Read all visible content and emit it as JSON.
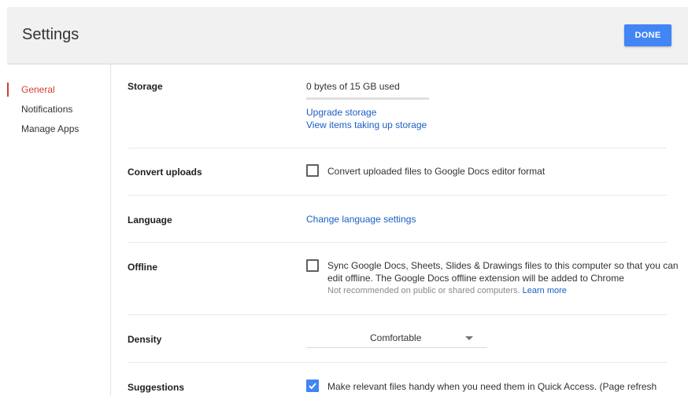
{
  "header": {
    "title": "Settings",
    "done_label": "DONE"
  },
  "sidebar": {
    "items": [
      {
        "label": "General",
        "active": true
      },
      {
        "label": "Notifications",
        "active": false
      },
      {
        "label": "Manage Apps",
        "active": false
      }
    ]
  },
  "storage": {
    "label": "Storage",
    "usage": "0 bytes of 15 GB used",
    "usage_fraction": 0,
    "upgrade_link": "Upgrade storage",
    "view_items_link": "View items taking up storage"
  },
  "convert_uploads": {
    "label": "Convert uploads",
    "checkbox_text": "Convert uploaded files to Google Docs editor format",
    "checked": false
  },
  "language": {
    "label": "Language",
    "link": "Change language settings"
  },
  "offline": {
    "label": "Offline",
    "checkbox_text_line1": "Sync Google Docs, Sheets, Slides & Drawings files to this computer so that you can",
    "checkbox_text_line2": "edit offline. The Google Docs offline extension will be added to Chrome",
    "note": "Not recommended on public or shared computers.",
    "learn_more": "Learn more",
    "checked": false
  },
  "density": {
    "label": "Density",
    "selected": "Comfortable"
  },
  "suggestions": {
    "label": "Suggestions",
    "checkbox_text": "Make relevant files handy when you need them in Quick Access. (Page refresh",
    "checked": true
  },
  "colors": {
    "accent": "#4285f4",
    "active_nav": "#d23f31",
    "link": "#1a5fc4"
  }
}
